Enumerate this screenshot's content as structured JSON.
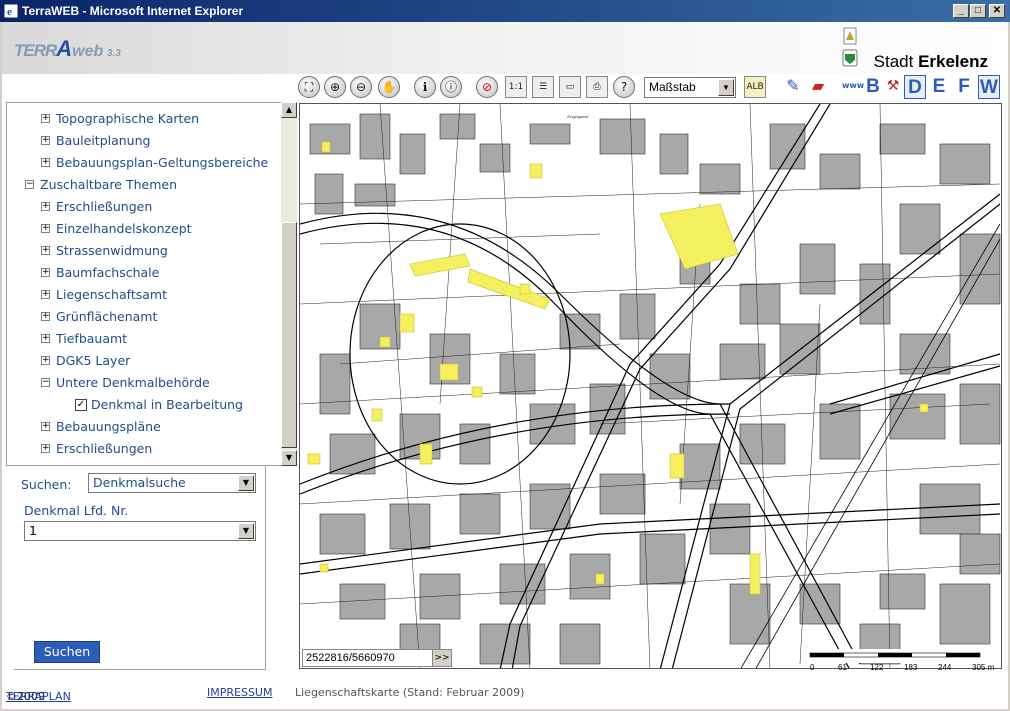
{
  "window": {
    "title": "TerraWEB - Microsoft Internet Explorer",
    "buttons": [
      "_",
      "□",
      "✕"
    ]
  },
  "header": {
    "logo_terra": "TERR",
    "logo_a": "A",
    "logo_web": "web",
    "logo_version": "3.3",
    "city_prefix": "Stadt ",
    "city_name": "Erkelenz"
  },
  "toolbar": {
    "massstab_label": "Maßstab",
    "alb_label": "ALB",
    "www_label": "www",
    "letters": [
      "B",
      "D",
      "E",
      "F",
      "W"
    ],
    "accent_color": "#2a5cb8"
  },
  "tree": {
    "items": [
      {
        "label": "Topographische Karten",
        "state": "+"
      },
      {
        "label": "Bauleitplanung",
        "state": "+"
      },
      {
        "label": "Bebauungsplan-Geltungsbereiche",
        "state": "+"
      },
      {
        "label": "Zuschaltbare Themen",
        "state": "-"
      },
      {
        "label": "Erschließungen",
        "state": "+"
      },
      {
        "label": "Einzelhandelskonzept",
        "state": "+"
      },
      {
        "label": "Strassenwidmung",
        "state": "+"
      },
      {
        "label": "Baumfachschale",
        "state": "+"
      },
      {
        "label": "Liegenschaftsamt",
        "state": "+"
      },
      {
        "label": "Grünflächenamt",
        "state": "+"
      },
      {
        "label": "Tiefbauamt",
        "state": "+"
      },
      {
        "label": "DGK5 Layer",
        "state": "+"
      },
      {
        "label": "Untere Denkmalbehörde",
        "state": "-"
      },
      {
        "label": "Denkmal in Bearbeitung",
        "state": "checked"
      },
      {
        "label": "Bebauungspläne",
        "state": "+"
      },
      {
        "label": "Erschließungen",
        "state": "+"
      }
    ]
  },
  "search": {
    "suchen_label": "Suchen:",
    "suchen_value": "Denkmalsuche",
    "denkmal_label": "Denkmal Lfd. Nr.",
    "denkmal_value": "1",
    "button_label": "Suchen"
  },
  "map": {
    "coordinates": "2522816/5660970",
    "coord_button": ">>",
    "scale_ticks": [
      "0",
      "61",
      "122",
      "183",
      "244",
      "305 m"
    ],
    "street_label": "Zingelgasse",
    "highlight_color": "#f5f060"
  },
  "footer": {
    "copyright": "©2009 ",
    "terraplan": "TERRAPLAN",
    "impressum": "IMPRESSUM",
    "status": "Liegenschaftskarte (Stand: Februar 2009)"
  }
}
